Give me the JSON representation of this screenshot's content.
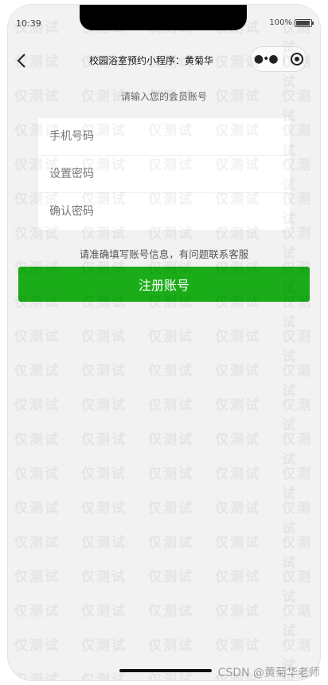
{
  "status_bar": {
    "time": "10:39",
    "battery_text": "100%"
  },
  "nav": {
    "title": "校园浴室预约小程序：黄菊华",
    "back_icon": "chevron-left-icon",
    "more_icon": "more-dots-icon",
    "close_icon": "capsule-target-icon"
  },
  "page": {
    "prompt": "请输入您的会员账号",
    "note": "请准确填写账号信息，有问题联系客服"
  },
  "form": {
    "phone_placeholder": "手机号码",
    "password_placeholder": "设置密码",
    "confirm_placeholder": "确认密码"
  },
  "register_button": {
    "label": "注册账号",
    "color": "#1aad19"
  },
  "watermark_text": "仅测试",
  "credit_text": "CSDN @黄菊华老师"
}
